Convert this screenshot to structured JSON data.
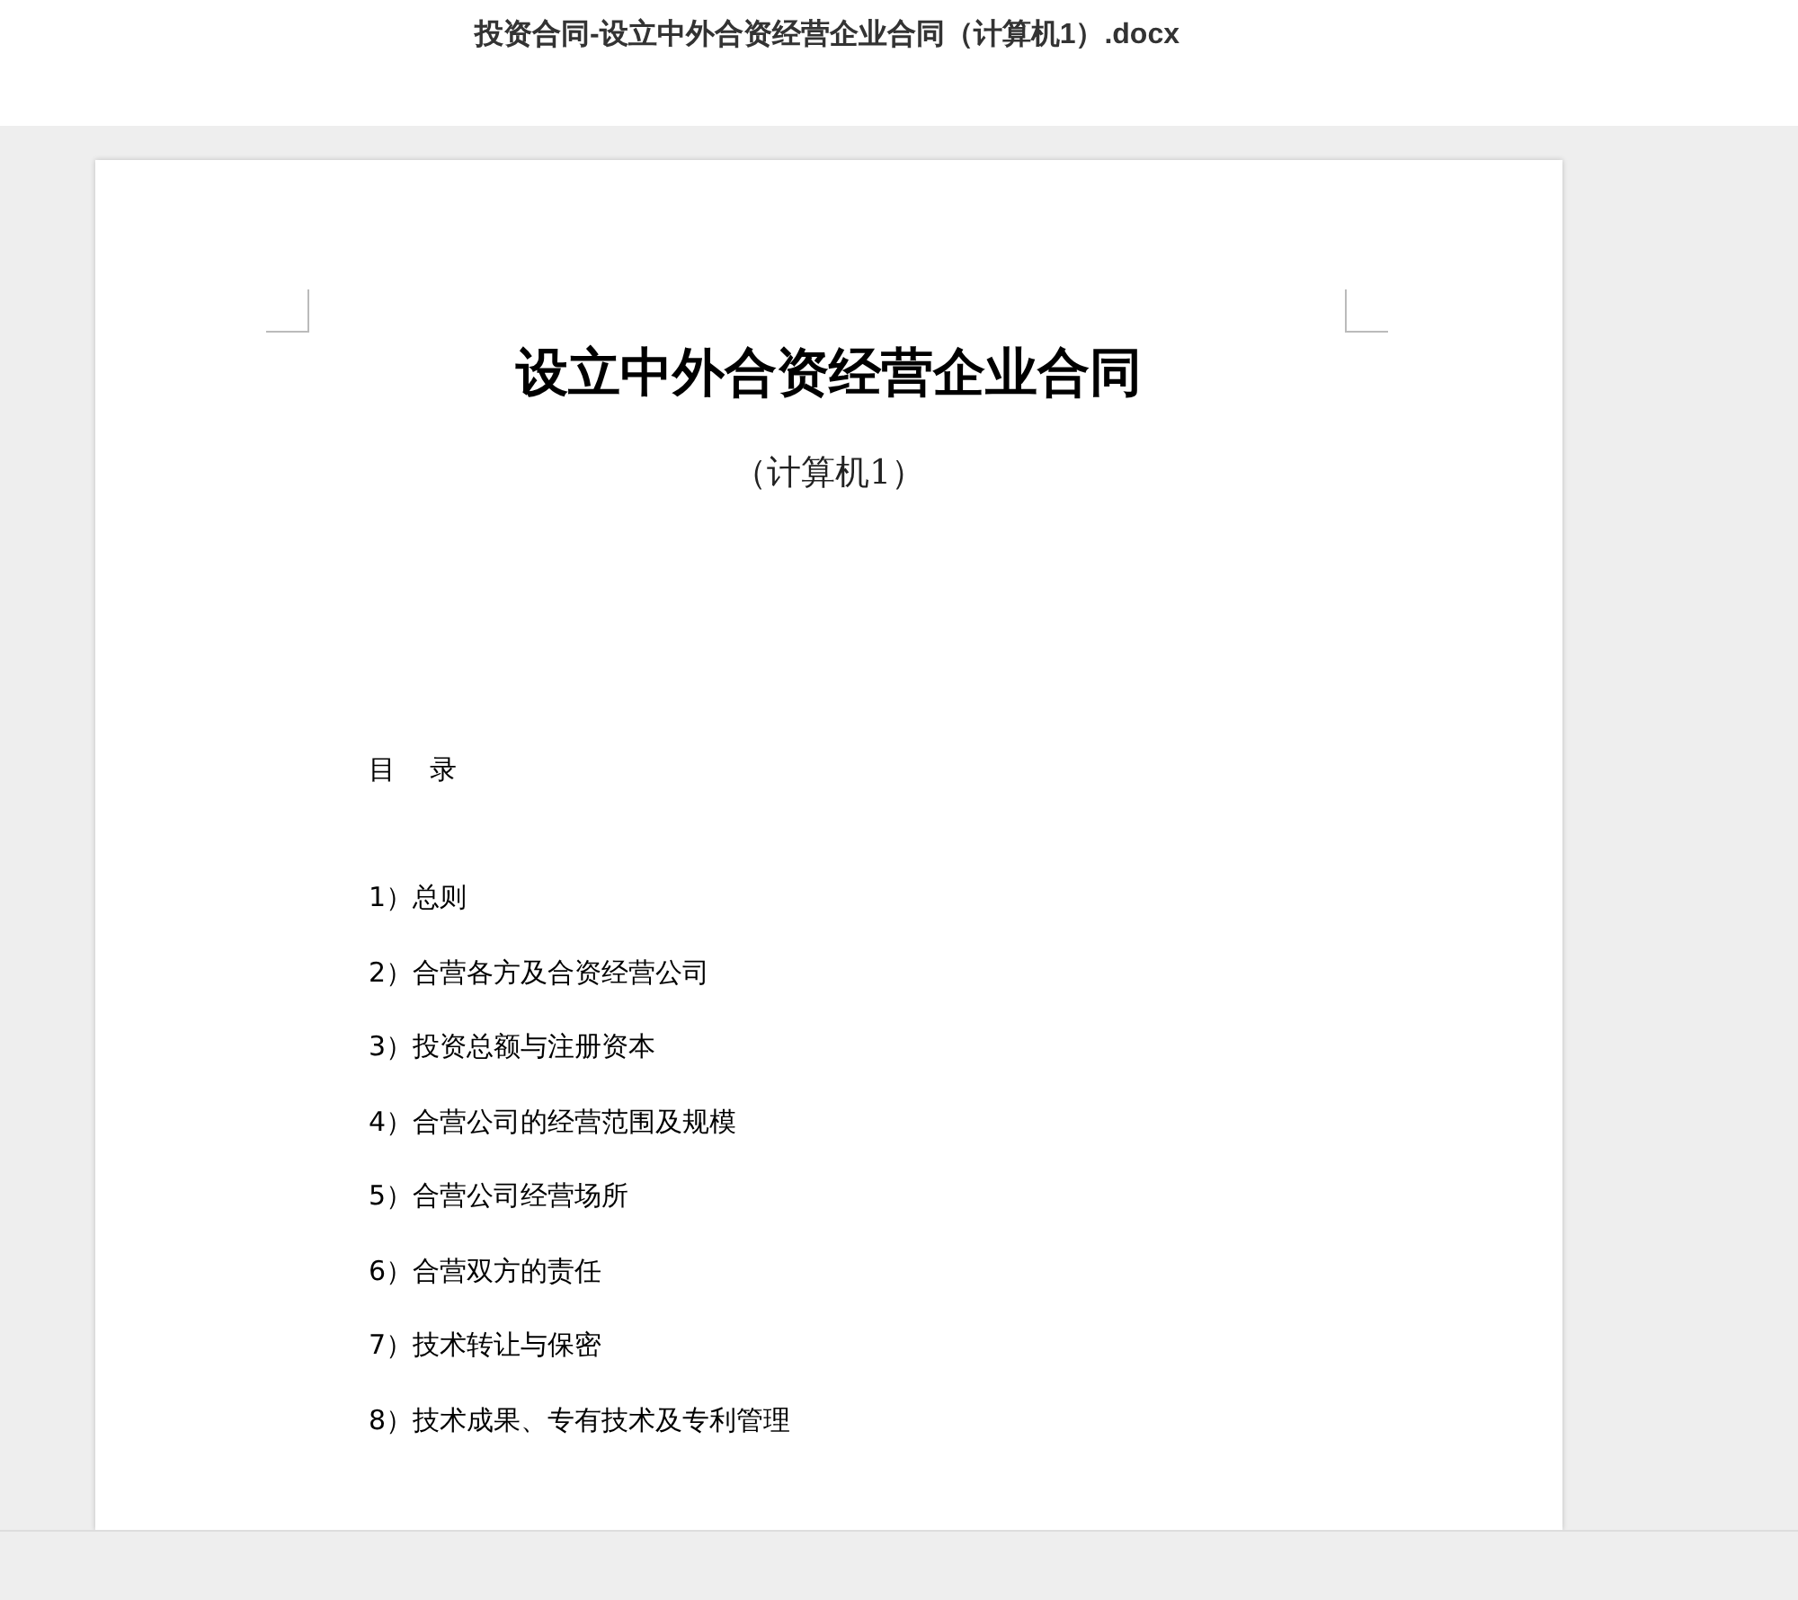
{
  "window": {
    "title": "投资合同-设立中外合资经营企业合同（计算机1）.docx"
  },
  "document": {
    "title": "设立中外合资经营企业合同",
    "subtitle": "（计算机1）",
    "toc_heading": "目    录",
    "toc_items": [
      "1）总则",
      "2）合营各方及合资经营公司",
      "3）投资总额与注册资本",
      "4）合营公司的经营范围及规模",
      "5）合营公司经营场所",
      "6）合营双方的责任",
      "7）技术转让与保密",
      "8）技术成果、专有技术及专利管理"
    ]
  }
}
